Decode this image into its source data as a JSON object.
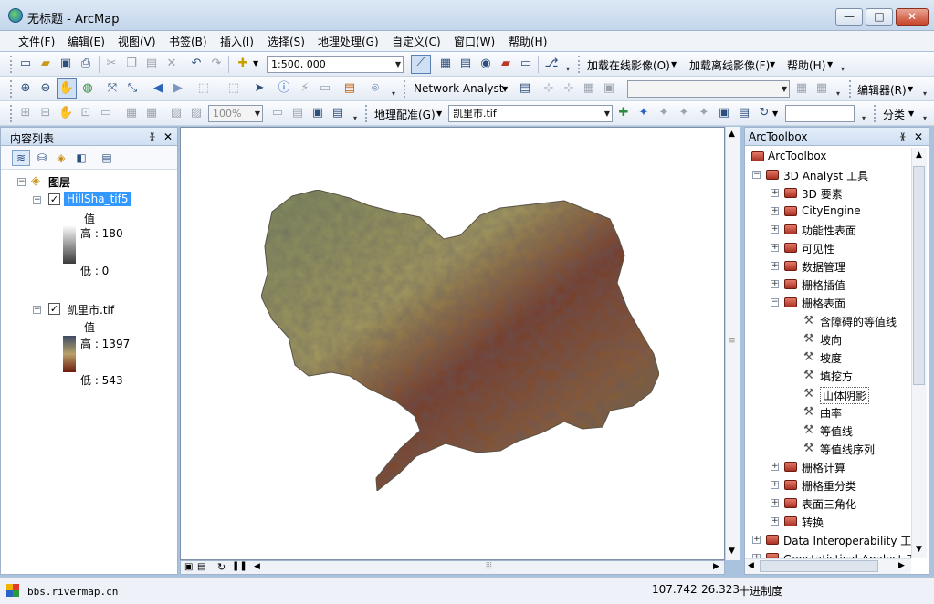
{
  "window": {
    "title": "无标题 - ArcMap",
    "minimize_glyph": "—",
    "maximize_glyph": "□",
    "close_glyph": "✕"
  },
  "menubar": {
    "items": [
      "文件(F)",
      "编辑(E)",
      "视图(V)",
      "书签(B)",
      "插入(I)",
      "选择(S)",
      "地理处理(G)",
      "自定义(C)",
      "窗口(W)",
      "帮助(H)"
    ]
  },
  "toolbar1": {
    "scale_value": "1:500, 000",
    "online_imagery": "加载在线影像(O)",
    "offline_imagery": "加载离线影像(F)",
    "help_menu": "帮助(H)"
  },
  "toolbar2": {
    "network_analyst": "Network Analyst",
    "editor": "编辑器(R)"
  },
  "toolbar3": {
    "zoom_value": "100%",
    "georeferencing": "地理配准(G)",
    "georef_layer": "凯里市.tif",
    "classify": "分类"
  },
  "toc": {
    "title": "内容列表",
    "layers_group": "图层",
    "layers": [
      {
        "name": "HillSha_tif5",
        "checked": true,
        "selected": true,
        "legend_title": "值",
        "high_label": "高 : 180",
        "low_label": "低 : 0",
        "ramp_colors": [
          "#ffffff",
          "#3a3a3a"
        ]
      },
      {
        "name": "凯里市.tif",
        "checked": true,
        "selected": false,
        "legend_title": "值",
        "high_label": "高 : 1397",
        "low_label": "低 : 543",
        "ramp_colors": [
          "#3d4a63",
          "#b9a16a",
          "#6b1a0c"
        ]
      }
    ]
  },
  "toolbox": {
    "title": "ArcToolbox",
    "root": "ArcToolbox",
    "items": [
      {
        "label": "3D Analyst 工具",
        "level": 1,
        "kind": "toolbox",
        "expanded": true
      },
      {
        "label": "3D 要素",
        "level": 2,
        "kind": "toolset",
        "expanded": false
      },
      {
        "label": "CityEngine",
        "level": 2,
        "kind": "toolset",
        "expanded": false
      },
      {
        "label": "功能性表面",
        "level": 2,
        "kind": "toolset",
        "expanded": false
      },
      {
        "label": "可见性",
        "level": 2,
        "kind": "toolset",
        "expanded": false
      },
      {
        "label": "数据管理",
        "level": 2,
        "kind": "toolset",
        "expanded": false
      },
      {
        "label": "栅格插值",
        "level": 2,
        "kind": "toolset",
        "expanded": false
      },
      {
        "label": "栅格表面",
        "level": 2,
        "kind": "toolset",
        "expanded": true
      },
      {
        "label": "含障碍的等值线",
        "level": 3,
        "kind": "tool"
      },
      {
        "label": "坡向",
        "level": 3,
        "kind": "tool"
      },
      {
        "label": "坡度",
        "level": 3,
        "kind": "tool"
      },
      {
        "label": "填挖方",
        "level": 3,
        "kind": "tool"
      },
      {
        "label": "山体阴影",
        "level": 3,
        "kind": "tool",
        "highlighted": true
      },
      {
        "label": "曲率",
        "level": 3,
        "kind": "tool"
      },
      {
        "label": "等值线",
        "level": 3,
        "kind": "tool"
      },
      {
        "label": "等值线序列",
        "level": 3,
        "kind": "tool"
      },
      {
        "label": "栅格计算",
        "level": 2,
        "kind": "toolset",
        "expanded": false
      },
      {
        "label": "栅格重分类",
        "level": 2,
        "kind": "toolset",
        "expanded": false
      },
      {
        "label": "表面三角化",
        "level": 2,
        "kind": "toolset",
        "expanded": false
      },
      {
        "label": "转换",
        "level": 2,
        "kind": "toolset",
        "expanded": false
      },
      {
        "label": "Data Interoperability 工",
        "level": 1,
        "kind": "toolbox",
        "expanded": false
      },
      {
        "label": "Geostatistical Analyst 工",
        "level": 1,
        "kind": "toolbox",
        "expanded": false
      }
    ]
  },
  "statusbar": {
    "watermark": "bbs.rivermap.cn",
    "coord_x": "107.742",
    "coord_y": "26.323",
    "units": "十进制度"
  },
  "colors": {
    "titlebar": "#c4d6ec",
    "selection": "#3399ff",
    "toolbox_icon": "#c8452b"
  }
}
